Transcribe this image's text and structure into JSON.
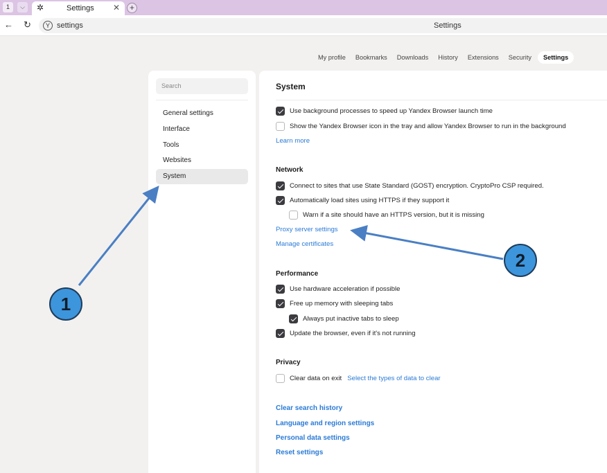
{
  "browser": {
    "tab_number": "1",
    "tab_dropdown_glyph": "⌵",
    "tab_icon": "gear-icon",
    "tab_icon_glyph": "✲",
    "tab_title": "Settings",
    "tab_close_glyph": "✕",
    "new_tab_glyph": "+",
    "back_glyph": "←",
    "reload_glyph": "↻",
    "logo_glyph": "Y",
    "address": "settings",
    "page_title": "Settings"
  },
  "topnav": {
    "items": [
      "My profile",
      "Bookmarks",
      "Downloads",
      "History",
      "Extensions",
      "Security",
      "Settings"
    ],
    "active": "Settings"
  },
  "sidebar": {
    "search_placeholder": "Search",
    "items": [
      "General settings",
      "Interface",
      "Tools",
      "Websites",
      "System"
    ],
    "active": "System"
  },
  "system": {
    "title": "System",
    "bg_processes": "Use background processes to speed up Yandex Browser launch time",
    "tray_icon": "Show the Yandex Browser icon in the tray and allow Yandex Browser to run in the background",
    "learn_more": "Learn more"
  },
  "network": {
    "title": "Network",
    "gost": "Connect to sites that use State Standard (GOST) encryption. CryptoPro CSP required.",
    "https": "Automatically load sites using HTTPS if they support it",
    "warn_https": "Warn if a site should have an HTTPS version, but it is missing",
    "proxy": "Proxy server settings",
    "certificates": "Manage certificates"
  },
  "performance": {
    "title": "Performance",
    "hw_accel": "Use hardware acceleration if possible",
    "sleeping_tabs": "Free up memory with sleeping tabs",
    "inactive_sleep": "Always put inactive tabs to sleep",
    "update": "Update the browser, even if it's not running"
  },
  "privacy": {
    "title": "Privacy",
    "clear_on_exit": "Clear data on exit",
    "select_types": "Select the types of data to clear"
  },
  "bottom_links": {
    "clear_search": "Clear search history",
    "language": "Language and region settings",
    "personal": "Personal data settings",
    "reset": "Reset settings"
  },
  "annotations": {
    "badge_1": "1",
    "badge_2": "2",
    "color": "#3d95dc"
  }
}
